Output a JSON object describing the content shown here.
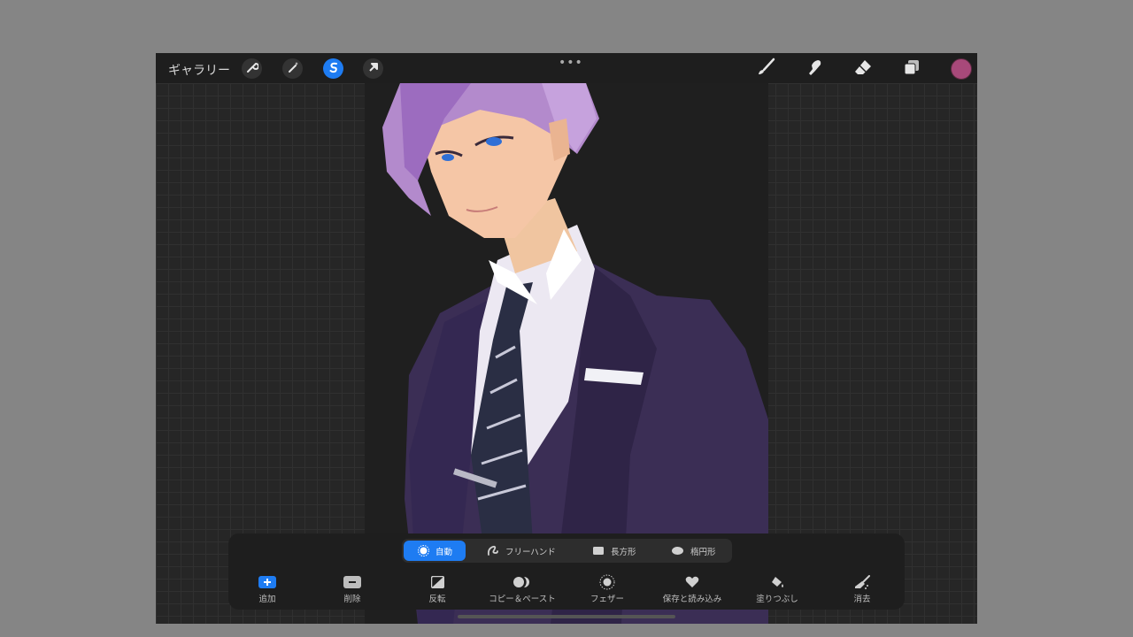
{
  "topbar": {
    "gallery_label": "ギャラリー",
    "more_dots": "•••",
    "current_color": "#a8497a"
  },
  "selection": {
    "modes": [
      {
        "label": "自動",
        "icon": "auto-icon",
        "active": true
      },
      {
        "label": "フリーハンド",
        "icon": "freehand-icon",
        "active": false
      },
      {
        "label": "長方形",
        "icon": "rectangle-icon",
        "active": false
      },
      {
        "label": "楕円形",
        "icon": "ellipse-icon",
        "active": false
      }
    ],
    "actions": [
      {
        "label": "追加",
        "icon": "add-icon"
      },
      {
        "label": "削除",
        "icon": "remove-icon"
      },
      {
        "label": "反転",
        "icon": "invert-icon"
      },
      {
        "label": "コピー＆ペースト",
        "icon": "copy-paste-icon"
      },
      {
        "label": "フェザー",
        "icon": "feather-icon"
      },
      {
        "label": "保存と読み込み",
        "icon": "save-load-icon"
      },
      {
        "label": "塗りつぶし",
        "icon": "color-fill-icon"
      },
      {
        "label": "消去",
        "icon": "clear-icon"
      }
    ]
  },
  "colors": {
    "accent": "#1e7cf2",
    "toolbar_bg": "#1e1e1e",
    "canvas_bg": "#1f1f1f"
  }
}
